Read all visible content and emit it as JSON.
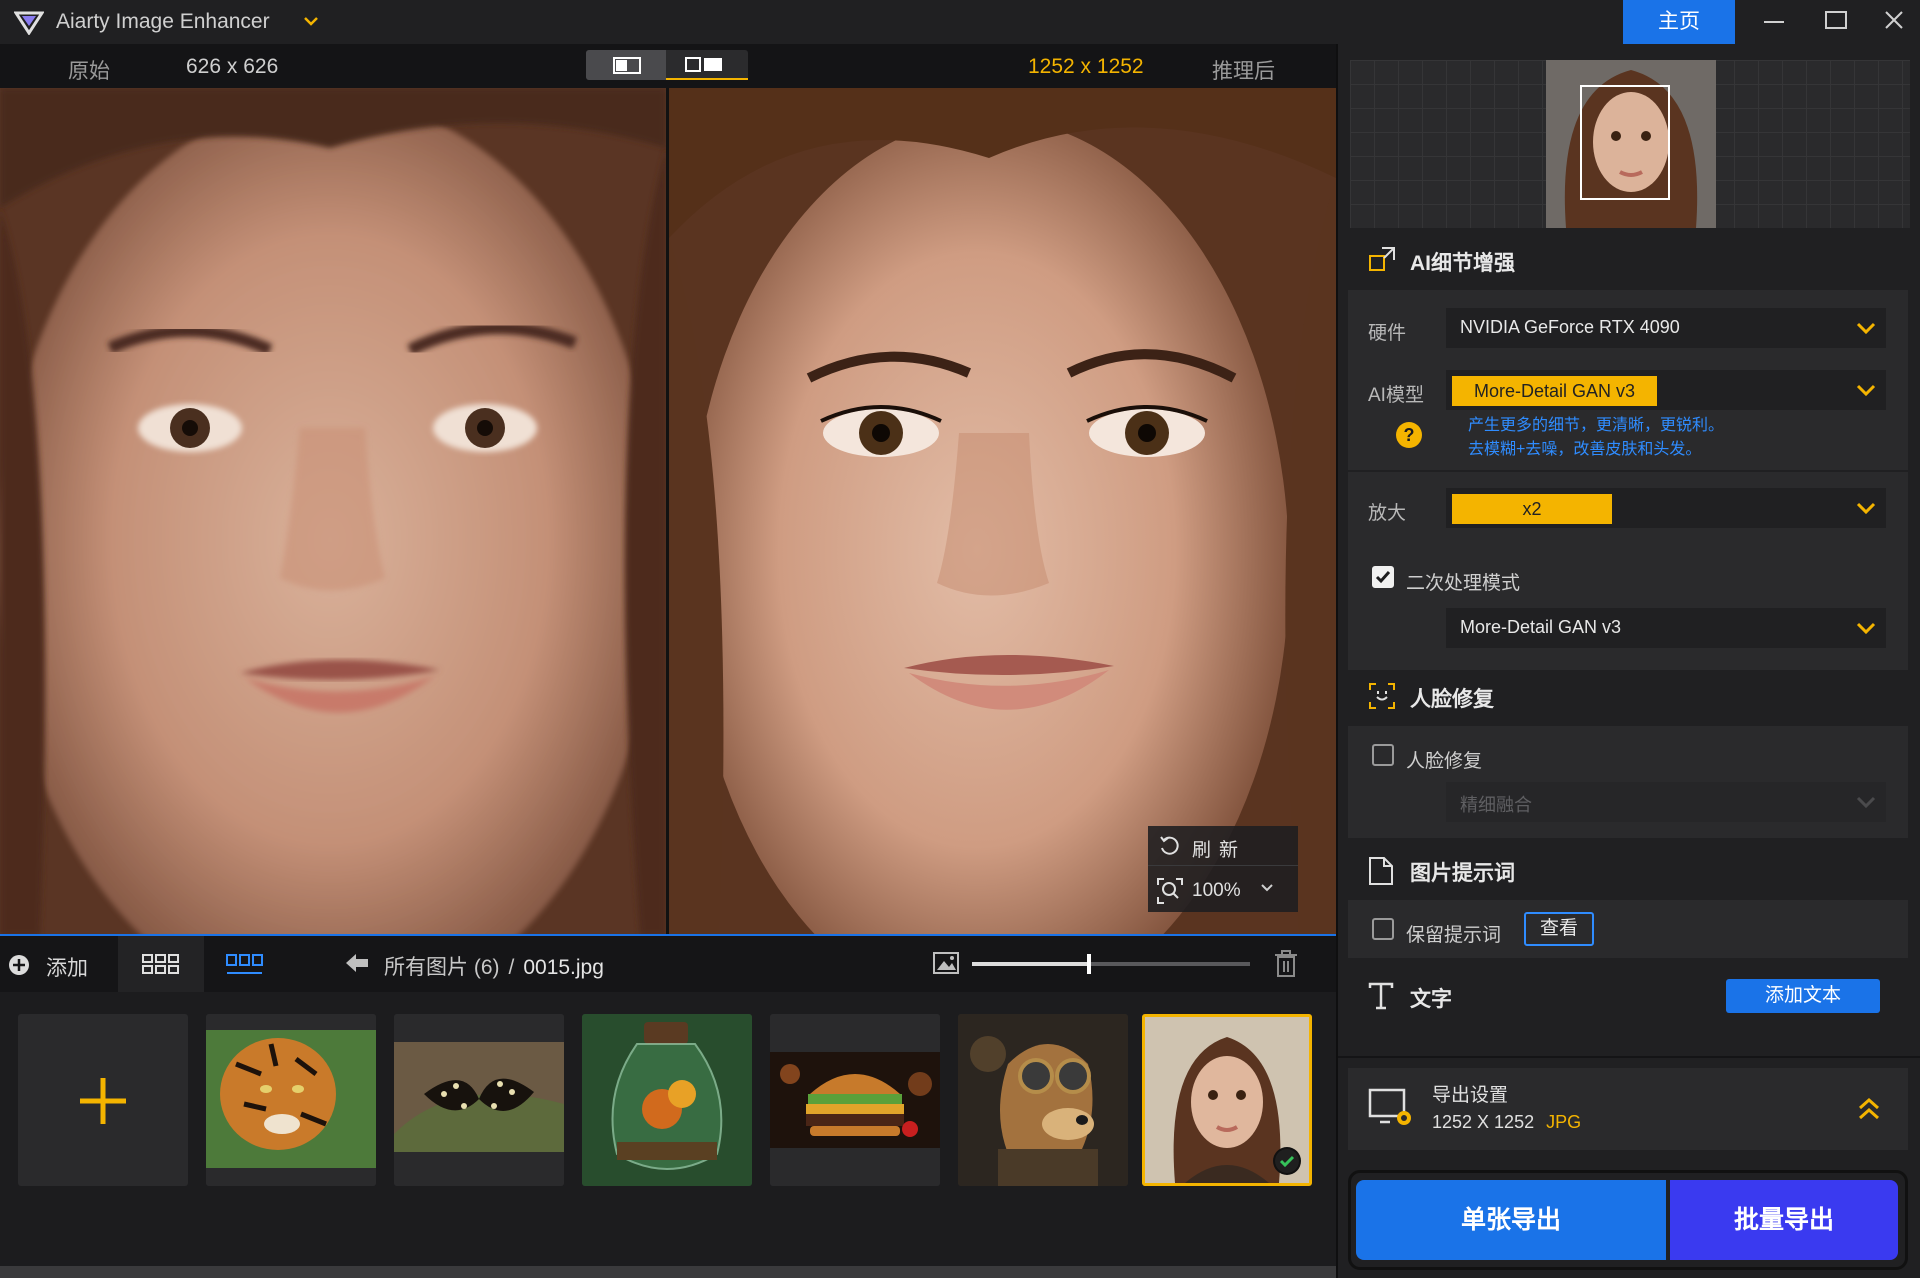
{
  "app": {
    "title": "Aiarty Image Enhancer",
    "home_label": "主页",
    "accent": "#f4b400",
    "primary_blue": "#1a73e8"
  },
  "compare": {
    "original_label": "原始",
    "original_size": "626 x 626",
    "result_size": "1252 x 1252",
    "result_label": "推理后",
    "refresh_label": "刷新",
    "zoom_label": "100%"
  },
  "file_bar": {
    "add_label": "添加",
    "breadcrumb_all": "所有图片 (6)",
    "breadcrumb_sep": "/",
    "current_file": "0015.jpg",
    "thumb_size_fraction": 0.42
  },
  "thumbnails": [
    {
      "name": "tiger",
      "icon": "tiger-image"
    },
    {
      "name": "butterfly",
      "icon": "butterfly-image"
    },
    {
      "name": "jar-terrarium",
      "icon": "terrarium-image"
    },
    {
      "name": "burger",
      "icon": "burger-image"
    },
    {
      "name": "steampunk-dog",
      "icon": "dog-image"
    },
    {
      "name": "portrait-girl",
      "icon": "portrait-image",
      "selected": true
    }
  ],
  "panel": {
    "enhance_title": "AI细节增强",
    "hardware_label": "硬件",
    "hardware_value": "NVIDIA GeForce RTX 4090",
    "model_label": "AI模型",
    "model_value": "More-Detail GAN  v3",
    "model_desc_1": "产生更多的细节，更清晰，更锐利。",
    "model_desc_2": "去模糊+去噪，改善皮肤和头发。",
    "help": "?",
    "scale_label": "放大",
    "scale_value": "x2",
    "second_pass_label": "二次处理模式",
    "second_pass_checked": true,
    "second_pass_model": "More-Detail GAN  v3",
    "face_title": "人脸修复",
    "face_checkbox_label": "人脸修复",
    "face_checked": false,
    "face_mode": "精细融合",
    "prompt_title": "图片提示词",
    "keep_prompt_label": "保留提示词",
    "keep_prompt_checked": false,
    "view_label": "查看",
    "text_title": "文字",
    "add_text_label": "添加文本",
    "export_title": "导出设置",
    "export_size": "1252 X 1252",
    "export_format": "JPG",
    "single_export": "单张导出",
    "batch_export": "批量导出"
  }
}
